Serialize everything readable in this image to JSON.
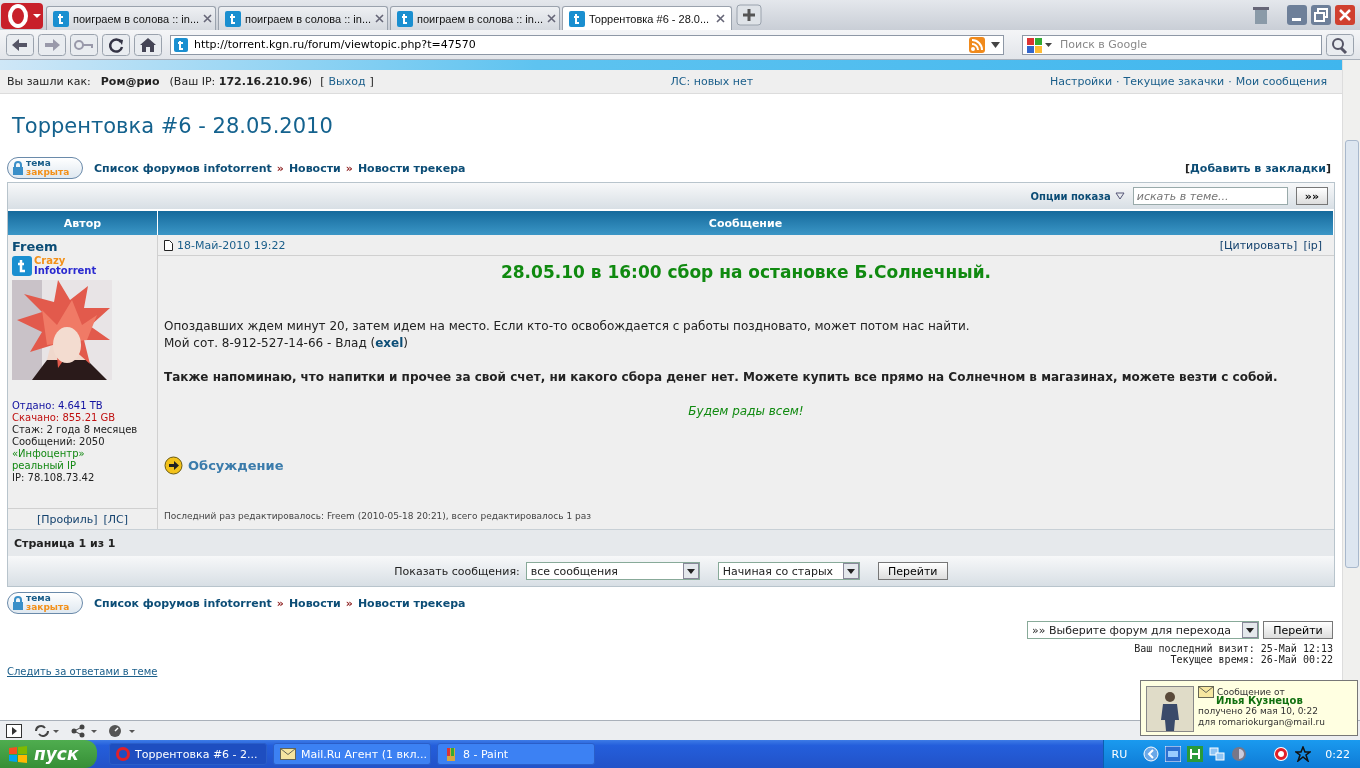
{
  "browser": {
    "tabs": [
      {
        "title": "поиграем в солова :: in...",
        "selected": false
      },
      {
        "title": "поиграем в солова :: in...",
        "selected": false
      },
      {
        "title": "поиграем в солова :: in...",
        "selected": false
      },
      {
        "title": "Торрентовка #6 - 28.0...",
        "selected": true
      }
    ],
    "address": "http://torrent.kgn.ru/forum/viewtopic.php?t=47570",
    "search_placeholder": "Поиск в Google"
  },
  "page": {
    "user_bar": {
      "logged_label": "Вы зашли как:",
      "username": "Ром@рио",
      "ip_text": "(Ваш IP: **172.16.210.96**)",
      "logout_open": "[",
      "logout": "Выход",
      "logout_close": "]",
      "pm_status": "ЛС: новых нет",
      "links": [
        "Настройки",
        "Текущие закачки",
        "Мои сообщения"
      ],
      "separators": [
        "·",
        "·"
      ]
    },
    "title": "Торрентовка #6 - 28.05.2010",
    "nav_top": {
      "locked_badge": [
        "тема",
        "закрыта"
      ],
      "breadcrumbs": [
        "Список форумов infotorrent",
        "Новости",
        "Новости трекера"
      ],
      "separators": [
        "»",
        "»"
      ]
    },
    "bookmark": {
      "open": "[",
      "label": "Добавить в закладки",
      "close": "]"
    },
    "display_options": "Опции показа",
    "topic_search_placeholder": "искать в теме...",
    "topic_search_button": "»»",
    "columns": [
      "Автор",
      "Сообщение"
    ],
    "post": {
      "author": "Freem",
      "rank_badge": [
        "Crazy",
        "Infotorrent"
      ],
      "stats": [
        {
          "text": "Отдано: 4.641 TB",
          "color": "#1010a0"
        },
        {
          "text": "Скачано: 855.21 GB",
          "color": "#c01010"
        },
        {
          "text": "Стаж: 2 года 8 месяцев",
          "color": "#222222"
        },
        {
          "text": "Сообщений: 2050",
          "color": "#222222"
        },
        {
          "text": "«Инфоцентр»",
          "color": "#118811"
        },
        {
          "text": "реальный IP",
          "color": "#118811"
        },
        {
          "text": "IP: 78.108.73.42",
          "color": "#222222"
        }
      ],
      "profile_links": [
        "[Профиль]",
        "[ЛС]"
      ],
      "date": "18-Май-2010 19:22",
      "actions": [
        "[Цитировать]",
        "[ip]"
      ],
      "heading": "28.05.10 в 16:00 сбор на остановке Б.Солнечный.",
      "lines": [
        "Опоздавших ждем минут 20, затем идем на место. Если кто-то освобождается с работы поздновато, может потом нас найти.",
        "Мой сот. 8-912-527-14-66 - Влад ("
      ],
      "line_link": "exel",
      "line_end": ")",
      "bold_paragraph": "Также напоминаю, что напитки и прочее за свой счет, ни какого сбора денег нет. Можете купить все прямо на Солнечном в магазинах, можете везти с собой.",
      "closing": "Будем рады всем!",
      "discussion_link": "Обсуждение",
      "edited_note": "Последний раз редактировалось: Freem (2010-05-18 20:21), всего редактировалось 1 раз"
    },
    "pagination": "Страница 1 из 1",
    "filter": {
      "label": "Показать сообщения:",
      "show": "все сообщения",
      "order": "Начиная со старых",
      "button": "Перейти"
    },
    "nav_bottom": {
      "locked_badge": [
        "тема",
        "закрыта"
      ],
      "breadcrumbs": [
        "Список форумов infotorrent",
        "Новости",
        "Новости трекера"
      ],
      "separators": [
        "»",
        "»"
      ]
    },
    "jump": {
      "select": "»» Выберите форум для перехода",
      "button": "Перейти"
    },
    "times": [
      "Ваш последний визит: 25-Май 12:13",
      "Текущее время: 26-Май 00:22"
    ],
    "watch_link": "Следить за ответами в теме"
  },
  "taskbar": {
    "start": "пуск",
    "items": [
      {
        "label": "Торрентовка #6 - 2...",
        "selected": true,
        "kind": "browser"
      },
      {
        "label": "Mail.Ru Агент (1 вкл...",
        "selected": false,
        "kind": "mail"
      },
      {
        "label": "8 - Paint",
        "selected": false,
        "kind": "paint"
      }
    ],
    "language": "RU",
    "clock": "0:22"
  },
  "notification": {
    "title": "Сообщение от",
    "sender": "Илья Кузнецов",
    "received": "получено  26 мая 10, 0:22",
    "recipient": "для romariokurgan@mail.ru"
  }
}
